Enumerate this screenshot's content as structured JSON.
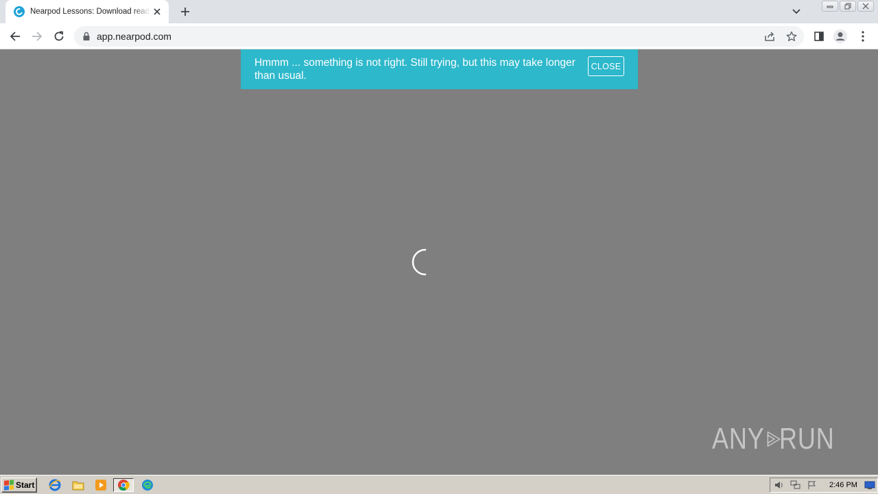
{
  "browser": {
    "tab": {
      "title": "Nearpod Lessons: Download ready-to-teach",
      "favicon": "nearpod-favicon-icon"
    },
    "new_tab_label": "+",
    "address_bar": {
      "url": "app.nearpod.com"
    }
  },
  "page": {
    "alert": {
      "message": "Hmmm ... something is not right. Still trying, but this may take longer than usual.",
      "close_label": "CLOSE",
      "background_color": "#2db8cb"
    },
    "loading_spinner": "loading-spinner-icon",
    "background_color": "#7f7f7f"
  },
  "watermark": {
    "text_left": "ANY",
    "text_right": "RUN"
  },
  "taskbar": {
    "start_label": "Start",
    "pinned": [
      "internet-explorer-icon",
      "file-explorer-icon",
      "media-player-icon",
      "chrome-icon",
      "edge-icon"
    ],
    "clock": "2:46 PM"
  }
}
